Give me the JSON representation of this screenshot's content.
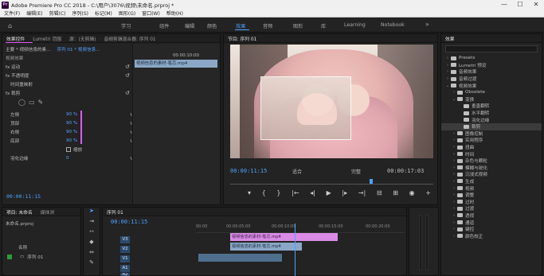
{
  "window": {
    "title": "Adobe Premiere Pro CC 2018 - C:\\用户\\3076\\视频\\未命名.prproj *",
    "app_badge": "Pr",
    "minimize": "—",
    "maximize": "☐",
    "close": "✕"
  },
  "menu": [
    "文件(F)",
    "编辑(E)",
    "剪辑(C)",
    "序列(S)",
    "标记(M)",
    "图形(G)",
    "窗口(W)",
    "帮助(H)"
  ],
  "workspaces": [
    {
      "label": "学习",
      "active": false
    },
    {
      "label": "组件",
      "active": false
    },
    {
      "label": "编辑",
      "active": false
    },
    {
      "label": "颜色",
      "active": false
    },
    {
      "label": "效果",
      "active": true
    },
    {
      "label": "音频",
      "active": false
    },
    {
      "label": "图形",
      "active": false
    },
    {
      "label": "库",
      "active": false
    },
    {
      "label": "Learning",
      "active": false
    },
    {
      "label": "Notebook",
      "active": false
    }
  ],
  "workspaces_more": "»",
  "effect_controls": {
    "tabs": [
      "效果控件",
      "Lumetri 范围",
      "源：(无剪辑)",
      "音频剪辑混合器: 序列 01"
    ],
    "source": "主要 * 视频信息的素...",
    "sequence": "序列 01 * 视频信息...",
    "clip_time": "00:00:10:00",
    "clip_name": "视频信息的素材-笔芯.mp4",
    "section_video": "视频效果",
    "motion": "fx 运动",
    "opacity": "fx 不透明度",
    "time_remap": "时间重映射",
    "crop": "fx 裁剪",
    "left_label": "左侧",
    "left_value": "90 %",
    "top_label": "顶部",
    "top_value": "90 %",
    "right_label": "右侧",
    "right_value": "90 %",
    "bottom_label": "底部",
    "bottom_value": "90 %",
    "zoom_label": "缩放",
    "feather_label": "羽化边缘",
    "feather_value": "0",
    "current_time": "00:00:11:15"
  },
  "program": {
    "tab": "节目: 序列 01",
    "timecode": "00:00:11:15",
    "fit": "适合",
    "quality": "完整",
    "duration": "00:00:17:03",
    "controls": [
      "▾",
      "{",
      "}",
      "|←",
      "◂|",
      "▶",
      "|▸",
      "→|",
      "⊟",
      "⊞",
      "◉",
      "+"
    ]
  },
  "effects_panel": {
    "title": "效果",
    "items": [
      {
        "label": "Presets",
        "indent": 0,
        "arrow": "›"
      },
      {
        "label": "Lumetri 预设",
        "indent": 0,
        "arrow": "›"
      },
      {
        "label": "音频效果",
        "indent": 0,
        "arrow": "›"
      },
      {
        "label": "音频过渡",
        "indent": 0,
        "arrow": "›"
      },
      {
        "label": "视频效果",
        "indent": 0,
        "arrow": "⌄"
      },
      {
        "label": "Obsolete",
        "indent": 1,
        "arrow": "›"
      },
      {
        "label": "变换",
        "indent": 1,
        "arrow": "⌄"
      },
      {
        "label": "垂直翻转",
        "indent": 2,
        "arrow": ""
      },
      {
        "label": "水平翻转",
        "indent": 2,
        "arrow": ""
      },
      {
        "label": "羽化边缘",
        "indent": 2,
        "arrow": ""
      },
      {
        "label": "裁剪",
        "indent": 2,
        "arrow": "",
        "selected": true
      },
      {
        "label": "图像控制",
        "indent": 1,
        "arrow": "›"
      },
      {
        "label": "实用程序",
        "indent": 1,
        "arrow": "›"
      },
      {
        "label": "扭曲",
        "indent": 1,
        "arrow": "›"
      },
      {
        "label": "时间",
        "indent": 1,
        "arrow": "›"
      },
      {
        "label": "杂色与颗粒",
        "indent": 1,
        "arrow": "›"
      },
      {
        "label": "模糊与锐化",
        "indent": 1,
        "arrow": "›"
      },
      {
        "label": "沉浸式视频",
        "indent": 1,
        "arrow": "›"
      },
      {
        "label": "生成",
        "indent": 1,
        "arrow": "›"
      },
      {
        "label": "视频",
        "indent": 1,
        "arrow": "›"
      },
      {
        "label": "调整",
        "indent": 1,
        "arrow": "›"
      },
      {
        "label": "过时",
        "indent": 1,
        "arrow": "›"
      },
      {
        "label": "过渡",
        "indent": 1,
        "arrow": "›"
      },
      {
        "label": "透视",
        "indent": 1,
        "arrow": "›"
      },
      {
        "label": "通道",
        "indent": 1,
        "arrow": "›"
      },
      {
        "label": "键控",
        "indent": 1,
        "arrow": "›"
      },
      {
        "label": "颜色校正",
        "indent": 1,
        "arrow": "›"
      }
    ]
  },
  "project": {
    "tabs": [
      "项目: 未命名",
      "媒体浏"
    ],
    "file": "未命名.prproj",
    "col_name": "名称",
    "item": "序列 01"
  },
  "timeline": {
    "tab": "序列 01",
    "timecode": "00:00:11:15",
    "ticks": [
      "00:00",
      "00:00:05:00",
      "00:00:10:00",
      "00:00:15:00",
      "00:00:20:00"
    ],
    "tracks": [
      {
        "label": "V3"
      },
      {
        "label": "V2"
      },
      {
        "label": "V1"
      },
      {
        "label": "A1"
      },
      {
        "label": "A2"
      }
    ],
    "clip_v2": "视频信息的素材-笔芯.mp4",
    "clip_v1": "视频信息的素材-笔芯.mp4",
    "clip_v2_color": "#d98be6",
    "clip_v1_color": "#8aa7c7",
    "audio_clip_color": "#4f6f8f"
  },
  "accent": "#4ea2ff"
}
